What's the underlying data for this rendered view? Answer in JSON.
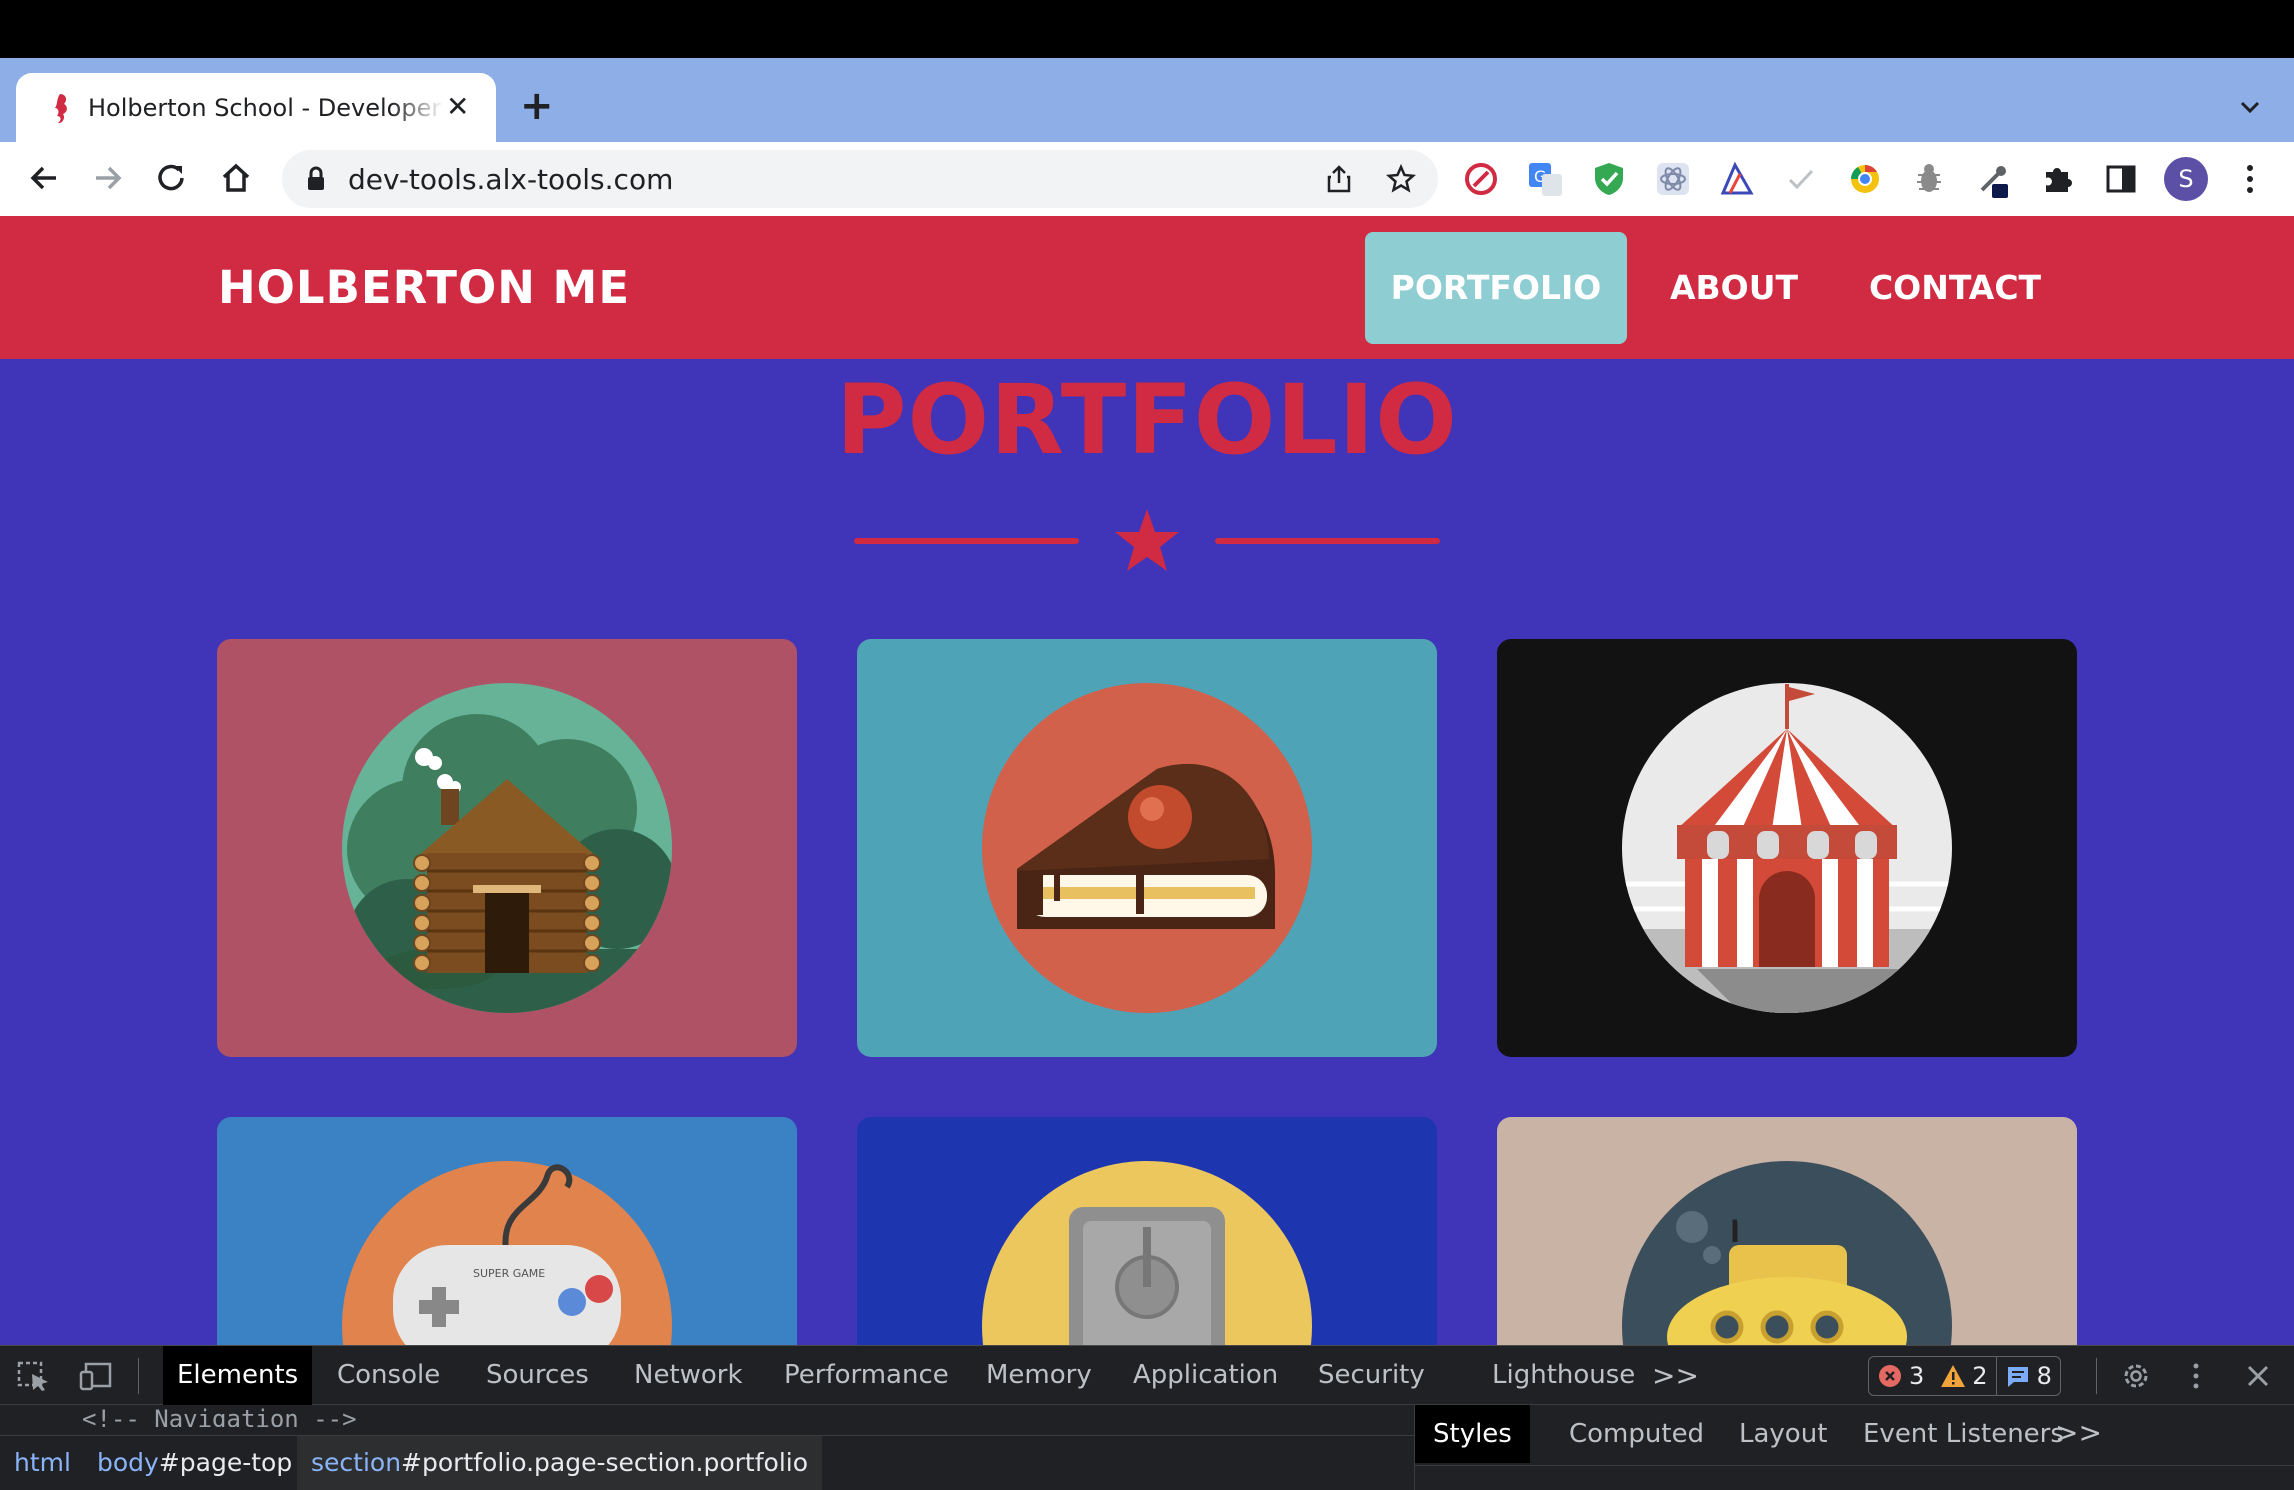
{
  "browser": {
    "tab_title": "Holberton School - Developer tools",
    "url": "dev-tools.alx-tools.com",
    "avatar_letter": "S"
  },
  "site": {
    "brand": "HOLBERTON ME",
    "nav": [
      {
        "label": "PORTFOLIO",
        "active": true
      },
      {
        "label": "ABOUT",
        "active": false
      },
      {
        "label": "CONTACT",
        "active": false
      }
    ],
    "section_title": "PORTFOLIO",
    "cards": [
      {
        "icon": "log-cabin-icon",
        "bg": "#b05266",
        "circle": "#66b397"
      },
      {
        "icon": "cake-slice-icon",
        "bg": "#4fa3b6",
        "circle": "#d2614b"
      },
      {
        "icon": "circus-tent-icon",
        "bg": "#121212",
        "circle": "#eaeaea"
      },
      {
        "icon": "game-controller-icon",
        "bg": "#3a82c4",
        "circle": "#e0834c"
      },
      {
        "icon": "safe-icon",
        "bg": "#1e35b0",
        "circle": "#ecc75e"
      },
      {
        "icon": "submarine-icon",
        "bg": "#c9b3a5",
        "circle": "#3b4e5c"
      }
    ],
    "colors": {
      "accent": "#d12a43",
      "page_bg": "#4034b8",
      "active_nav": "#8ecdd2"
    }
  },
  "devtools": {
    "tabs": [
      "Elements",
      "Console",
      "Sources",
      "Network",
      "Performance",
      "Memory",
      "Application",
      "Security",
      "Lighthouse"
    ],
    "active_tab": "Elements",
    "more": ">>",
    "errors": "3",
    "warnings": "2",
    "messages": "8",
    "comment": "<!-- Navigation -->",
    "breadcrumbs": {
      "html": "html",
      "body_tag": "body",
      "body_id": "#page-top",
      "section_tag": "section",
      "section_rest": "#portfolio.page-section.portfolio"
    },
    "side_tabs": [
      "Styles",
      "Computed",
      "Layout",
      "Event Listeners"
    ],
    "side_more": ">>"
  }
}
